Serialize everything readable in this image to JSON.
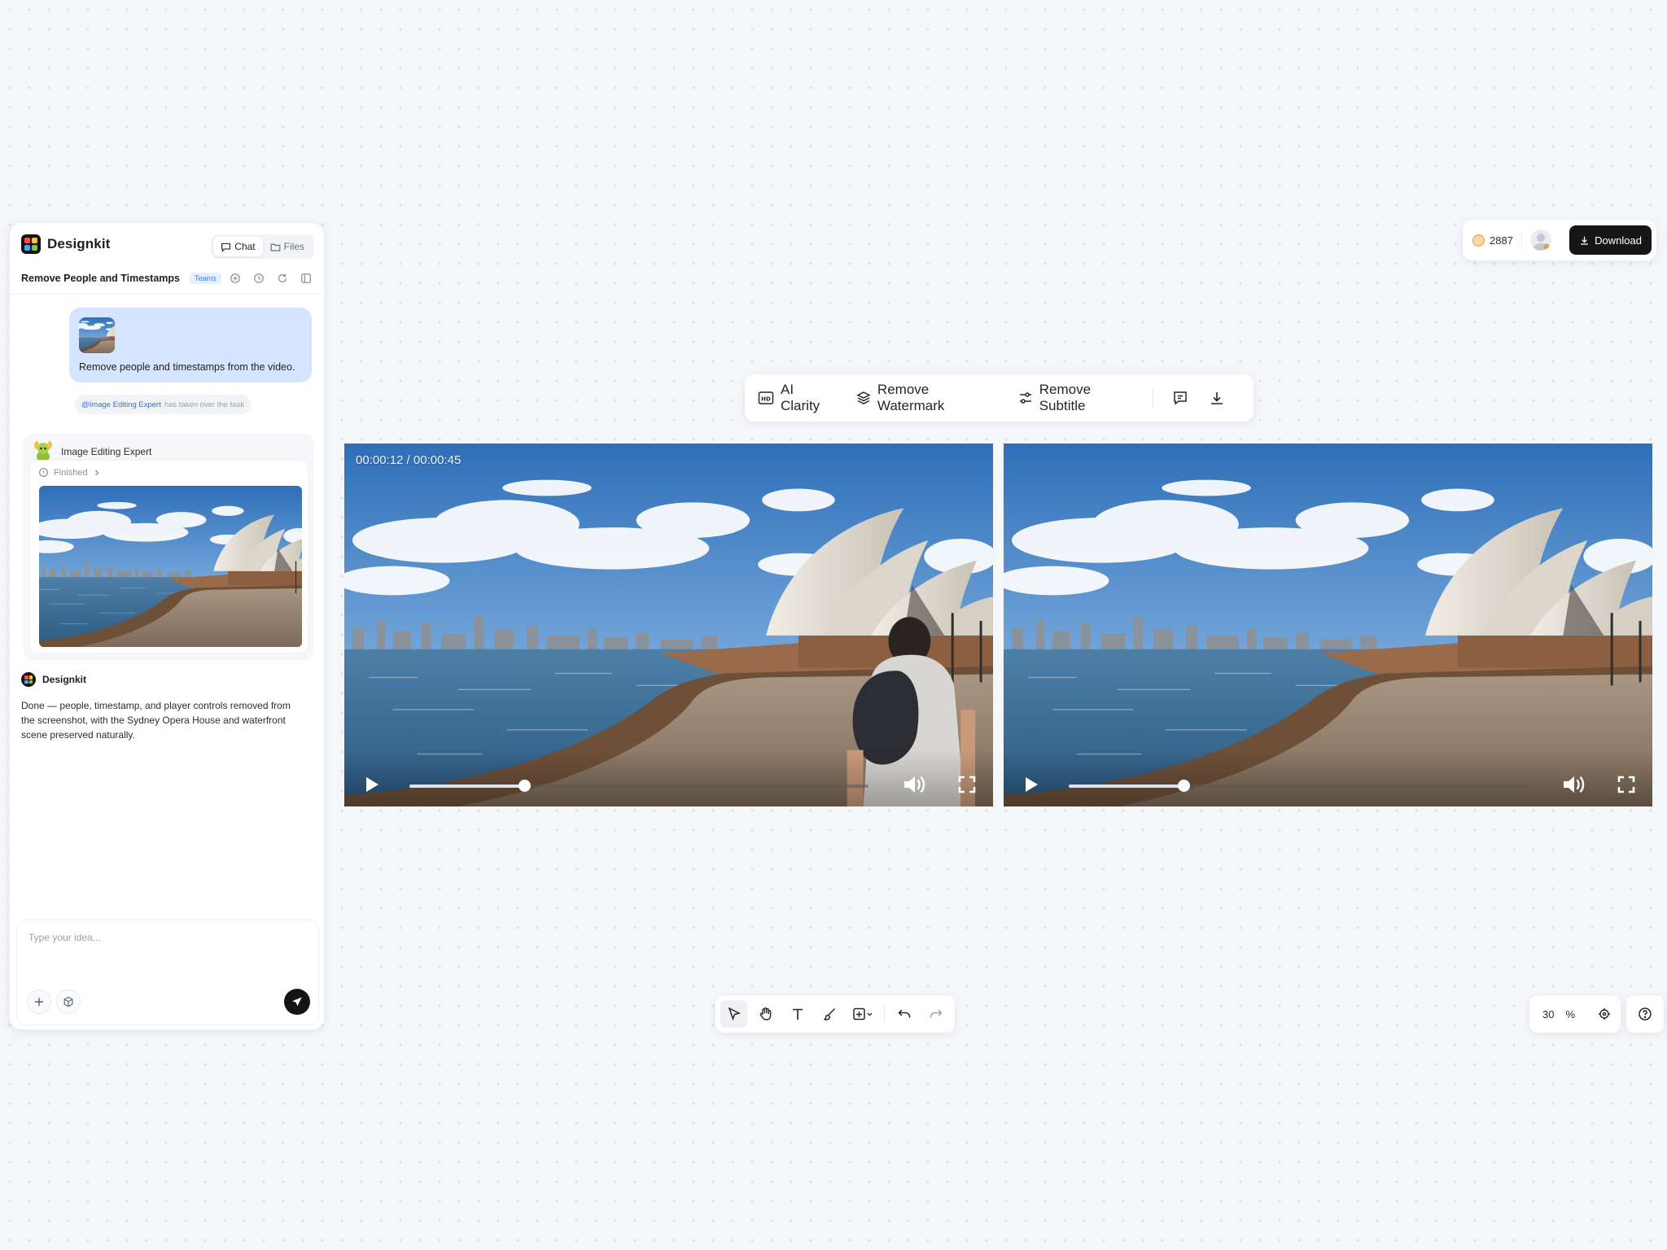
{
  "app": {
    "name": "Designkit"
  },
  "header_tabs": [
    {
      "label": "Chat",
      "active": true
    },
    {
      "label": "Files",
      "active": false
    }
  ],
  "task": {
    "title": "Remove People and Timestamps",
    "badge": "Teams"
  },
  "chat": {
    "user_message": "Remove people and timestamps from the video.",
    "system_note": {
      "mention": "@Image Editing Expert",
      "text": "has taken over the task"
    },
    "expert": {
      "name": "Image Editing Expert",
      "status": "Finished"
    },
    "reply": {
      "name": "Designkit",
      "text": "Done — people, timestamp, and player controls removed from the screenshot, with the Sydney Opera House and waterfront scene preserved naturally."
    }
  },
  "composer": {
    "placeholder": "Type your idea..."
  },
  "topbar": {
    "credits": "2887",
    "download_label": "Download"
  },
  "ai_toolbar": {
    "items": [
      "AI Clarity",
      "Remove Watermark",
      "Remove Subtitle"
    ]
  },
  "players": [
    {
      "timecode": "00:00:12 / 00:00:45",
      "progress": 0.25,
      "has_person": true
    },
    {
      "timecode": "",
      "progress": 0.25,
      "has_person": false
    }
  ],
  "zoom": {
    "value": "30",
    "unit": "%"
  },
  "colors": {
    "accent": "#161616",
    "user_bubble": "#d5e5ff",
    "mention": "#2f6fe3",
    "badge": "#3a7cf0"
  }
}
